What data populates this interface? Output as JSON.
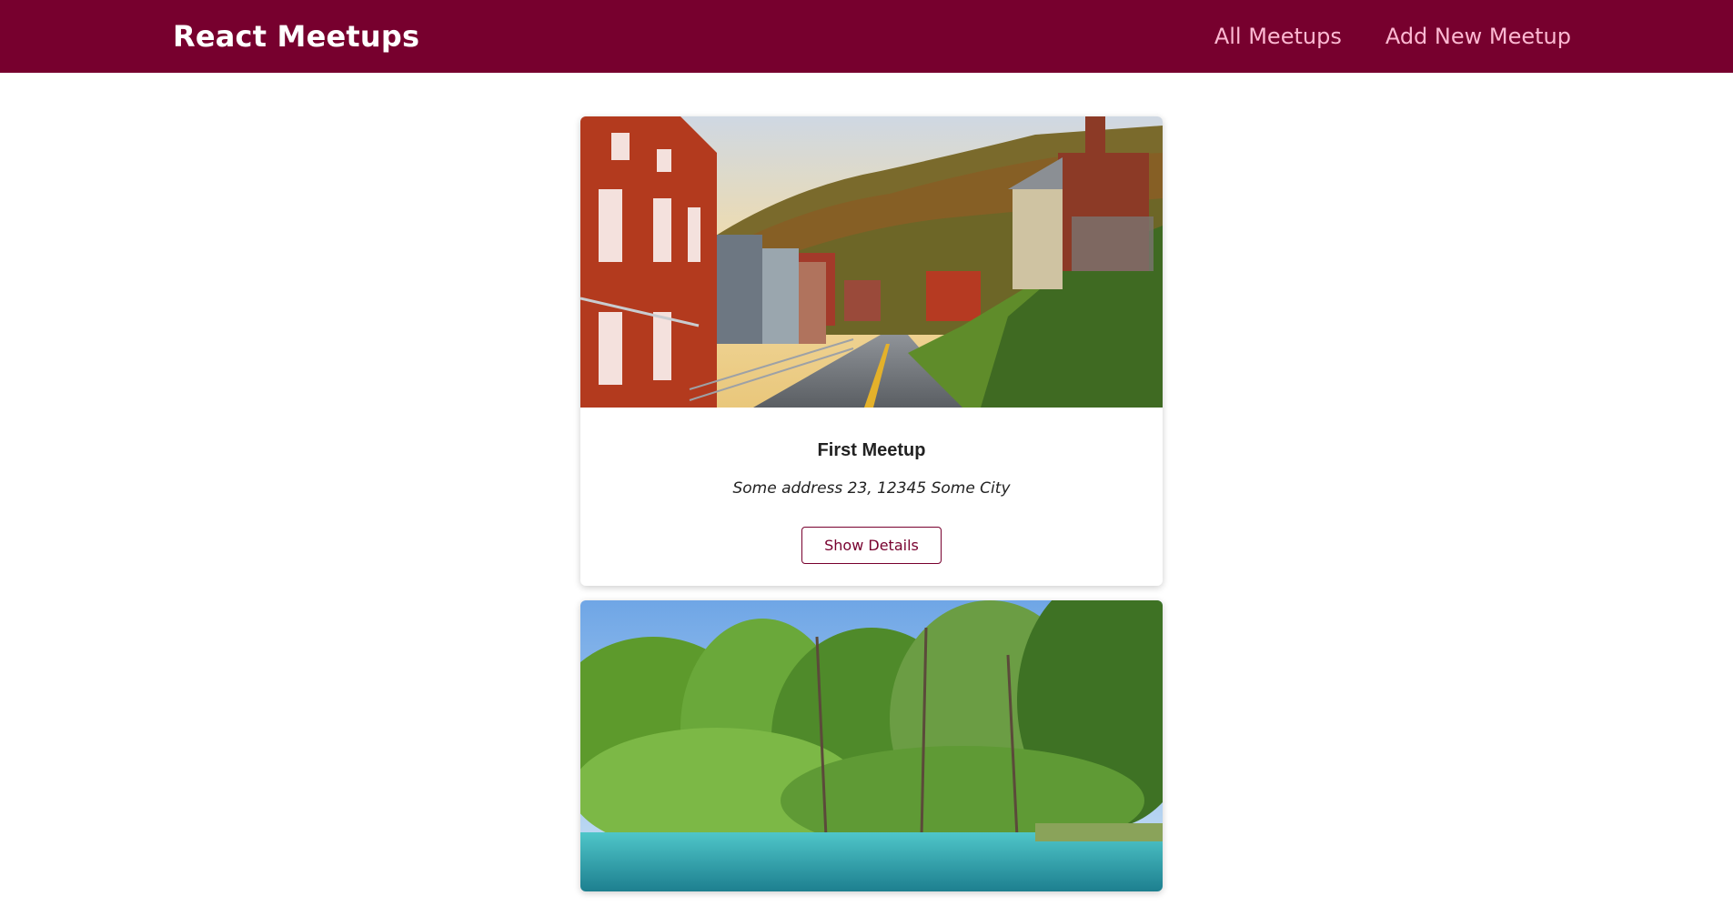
{
  "header": {
    "logo": "React Meetups",
    "nav": {
      "all_meetups": "All Meetups",
      "add_new_meetup": "Add New Meetup"
    }
  },
  "meetups": [
    {
      "title": "First Meetup",
      "address": "Some address 23, 12345 Some City",
      "button_label": "Show Details"
    }
  ],
  "colors": {
    "brand": "#77002e",
    "nav_link": "#fcb8d2"
  }
}
